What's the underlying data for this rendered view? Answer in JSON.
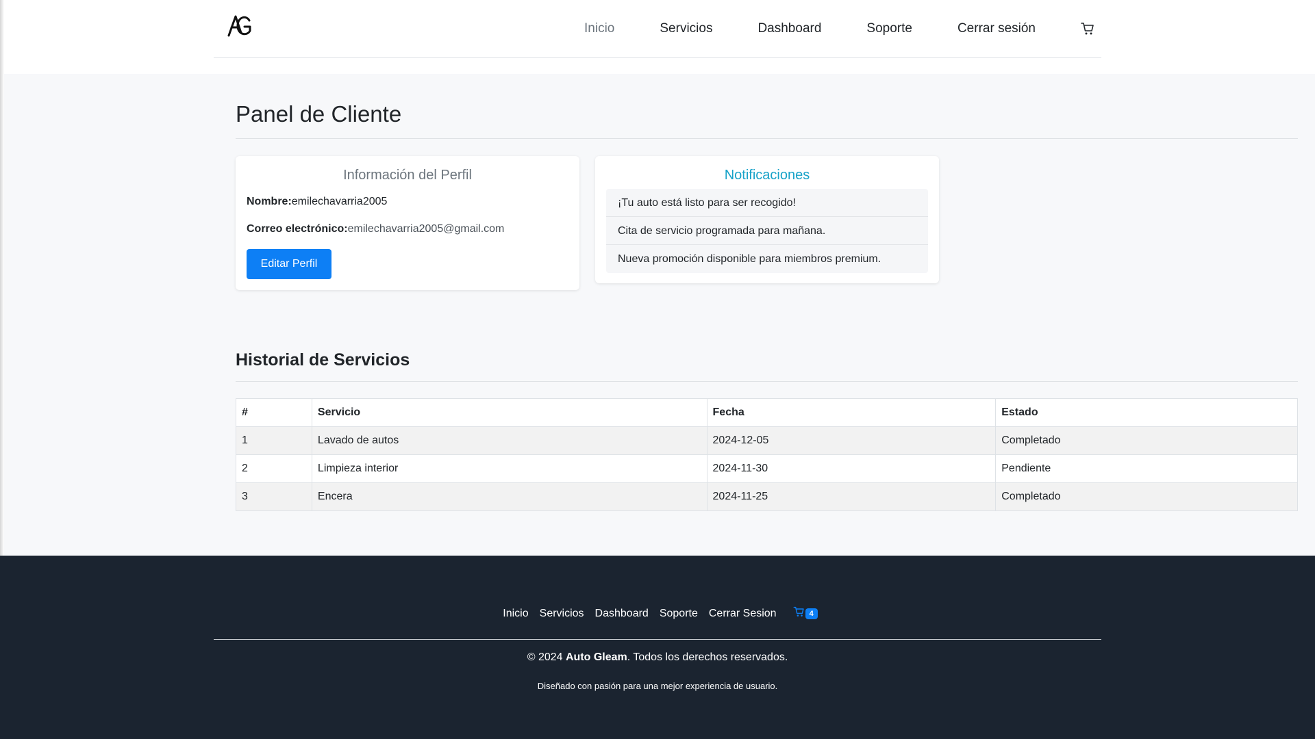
{
  "nav": {
    "logo_text": "AG",
    "links": [
      "Inicio",
      "Servicios",
      "Dashboard",
      "Soporte",
      "Cerrar sesión"
    ],
    "active": "Inicio",
    "cart_icon": "cart-icon"
  },
  "page": {
    "title": "Panel de Cliente"
  },
  "profile": {
    "title": "Información del Perfil",
    "name_label": "Nombre:",
    "name_value": "emilechavarria2005",
    "email_label": "Correo electrónico:",
    "email_value": "emilechavarria2005@gmail.com",
    "edit_button": "Editar Perfil"
  },
  "notifications": {
    "title": "Notificaciones",
    "items": [
      "¡Tu auto está listo para ser recogido!",
      "Cita de servicio programada para mañana.",
      "Nueva promoción disponible para miembros premium."
    ]
  },
  "history": {
    "title": "Historial de Servicios",
    "headers": [
      "#",
      "Servicio",
      "Fecha",
      "Estado"
    ],
    "rows": [
      [
        "1",
        "Lavado de autos",
        "2024-12-05",
        "Completado"
      ],
      [
        "2",
        "Limpieza interior",
        "2024-11-30",
        "Pendiente"
      ],
      [
        "3",
        "Encera",
        "2024-11-25",
        "Completado"
      ]
    ]
  },
  "footer": {
    "links": [
      "Inicio",
      "Servicios",
      "Dashboard",
      "Soporte",
      "Cerrar Sesion"
    ],
    "cart_count": "4",
    "copyright_prefix": "© 2024 ",
    "brand": "Auto Gleam",
    "copyright_suffix": ". Todos los derechos reservados.",
    "tagline": "Diseñado con pasión para una mejor experiencia de usuario."
  },
  "colors": {
    "primary": "#0d7ff5",
    "info": "#17a2c8",
    "footer_bg": "#1b2430",
    "main_bg": "#f7f8fa"
  }
}
